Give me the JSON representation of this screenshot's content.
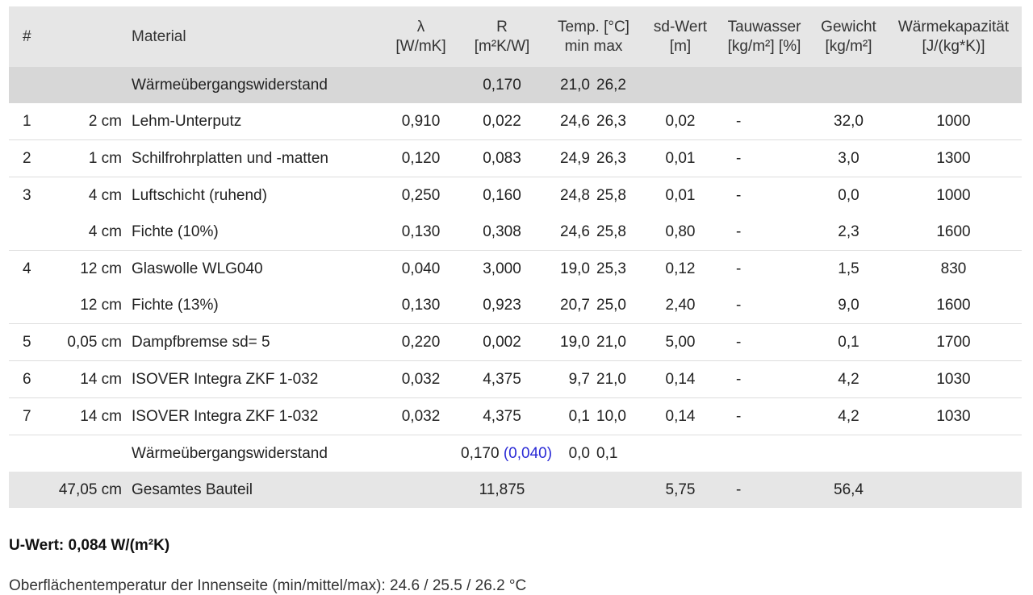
{
  "header": {
    "num": "#",
    "material": "Material",
    "lambda_symbol": "λ",
    "lambda_unit": "[W/mK]",
    "r_symbol": "R",
    "r_unit": "[m²K/W]",
    "temp_label": "Temp. [°C]",
    "temp_sub": "min max",
    "sd_label": "sd-Wert",
    "sd_unit": "[m]",
    "tau_label": "Tauwasser",
    "tau_unit": "[kg/m²] [%]",
    "weight_label": "Gewicht",
    "weight_unit": "[kg/m²]",
    "cap_label": "Wärmekapazität",
    "cap_unit": "[J/(kg*K)]"
  },
  "rows": [
    {
      "type": "uebergang",
      "num": "",
      "thickness": "",
      "material": "Wärmeübergangswiderstand",
      "lambda": "",
      "r": "0,170",
      "r_extra": "",
      "tmin": "21,0",
      "tmax": "26,2",
      "sd": "",
      "tau": "",
      "weight": "",
      "cap": ""
    },
    {
      "type": "layer",
      "num": "1",
      "thickness": "2 cm",
      "material": "Lehm-Unterputz",
      "lambda": "0,910",
      "r": "0,022",
      "r_extra": "",
      "tmin": "24,6",
      "tmax": "26,3",
      "sd": "0,02",
      "tau": "-",
      "weight": "32,0",
      "cap": "1000"
    },
    {
      "type": "layer",
      "num": "2",
      "thickness": "1 cm",
      "material": "Schilfrohrplatten und -matten",
      "lambda": "0,120",
      "r": "0,083",
      "r_extra": "",
      "tmin": "24,9",
      "tmax": "26,3",
      "sd": "0,01",
      "tau": "-",
      "weight": "3,0",
      "cap": "1300"
    },
    {
      "type": "layer-nobottom",
      "num": "3",
      "thickness": "4 cm",
      "material": "Luftschicht (ruhend)",
      "lambda": "0,250",
      "r": "0,160",
      "r_extra": "",
      "tmin": "24,8",
      "tmax": "25,8",
      "sd": "0,01",
      "tau": "-",
      "weight": "0,0",
      "cap": "1000"
    },
    {
      "type": "layer",
      "num": "",
      "thickness": "4 cm",
      "material": "Fichte (10%)",
      "lambda": "0,130",
      "r": "0,308",
      "r_extra": "",
      "tmin": "24,6",
      "tmax": "25,8",
      "sd": "0,80",
      "tau": "-",
      "weight": "2,3",
      "cap": "1600"
    },
    {
      "type": "layer-nobottom",
      "num": "4",
      "thickness": "12 cm",
      "material": "Glaswolle WLG040",
      "lambda": "0,040",
      "r": "3,000",
      "r_extra": "",
      "tmin": "19,0",
      "tmax": "25,3",
      "sd": "0,12",
      "tau": "-",
      "weight": "1,5",
      "cap": "830"
    },
    {
      "type": "layer",
      "num": "",
      "thickness": "12 cm",
      "material": "Fichte (13%)",
      "lambda": "0,130",
      "r": "0,923",
      "r_extra": "",
      "tmin": "20,7",
      "tmax": "25,0",
      "sd": "2,40",
      "tau": "-",
      "weight": "9,0",
      "cap": "1600"
    },
    {
      "type": "layer",
      "num": "5",
      "thickness": "0,05 cm",
      "material": "Dampfbremse sd= 5",
      "lambda": "0,220",
      "r": "0,002",
      "r_extra": "",
      "tmin": "19,0",
      "tmax": "21,0",
      "sd": "5,00",
      "tau": "-",
      "weight": "0,1",
      "cap": "1700"
    },
    {
      "type": "layer",
      "num": "6",
      "thickness": "14 cm",
      "material": "ISOVER Integra ZKF 1-032",
      "lambda": "0,032",
      "r": "4,375",
      "r_extra": "",
      "tmin": "9,7",
      "tmax": "21,0",
      "sd": "0,14",
      "tau": "-",
      "weight": "4,2",
      "cap": "1030"
    },
    {
      "type": "layer",
      "num": "7",
      "thickness": "14 cm",
      "material": "ISOVER Integra ZKF 1-032",
      "lambda": "0,032",
      "r": "4,375",
      "r_extra": "",
      "tmin": "0,1",
      "tmax": "10,0",
      "sd": "0,14",
      "tau": "-",
      "weight": "4,2",
      "cap": "1030"
    },
    {
      "type": "layer-nobottom",
      "num": "",
      "thickness": "",
      "material": "Wärmeübergangswiderstand",
      "lambda": "",
      "r": "0,170",
      "r_extra": "(0,040)",
      "tmin": "0,0",
      "tmax": "0,1",
      "sd": "",
      "tau": "",
      "weight": "",
      "cap": ""
    },
    {
      "type": "total",
      "num": "",
      "thickness": "47,05 cm",
      "material": "Gesamtes Bauteil",
      "lambda": "",
      "r": "11,875",
      "r_extra": "",
      "tmin": "",
      "tmax": "",
      "sd": "5,75",
      "tau": "-",
      "weight": "56,4",
      "cap": ""
    }
  ],
  "u_value": "U-Wert: 0,084 W/(m²K)",
  "surface_temp": "Oberflächentemperatur der Innenseite (min/mittel/max): 24.6 / 25.5 / 26.2 °C",
  "colors": {
    "header_bg": "#e6e6e6",
    "uebergang_bg": "#d7d7d7",
    "total_bg": "#e6e6e6",
    "link_blue": "#2a2ad6"
  }
}
